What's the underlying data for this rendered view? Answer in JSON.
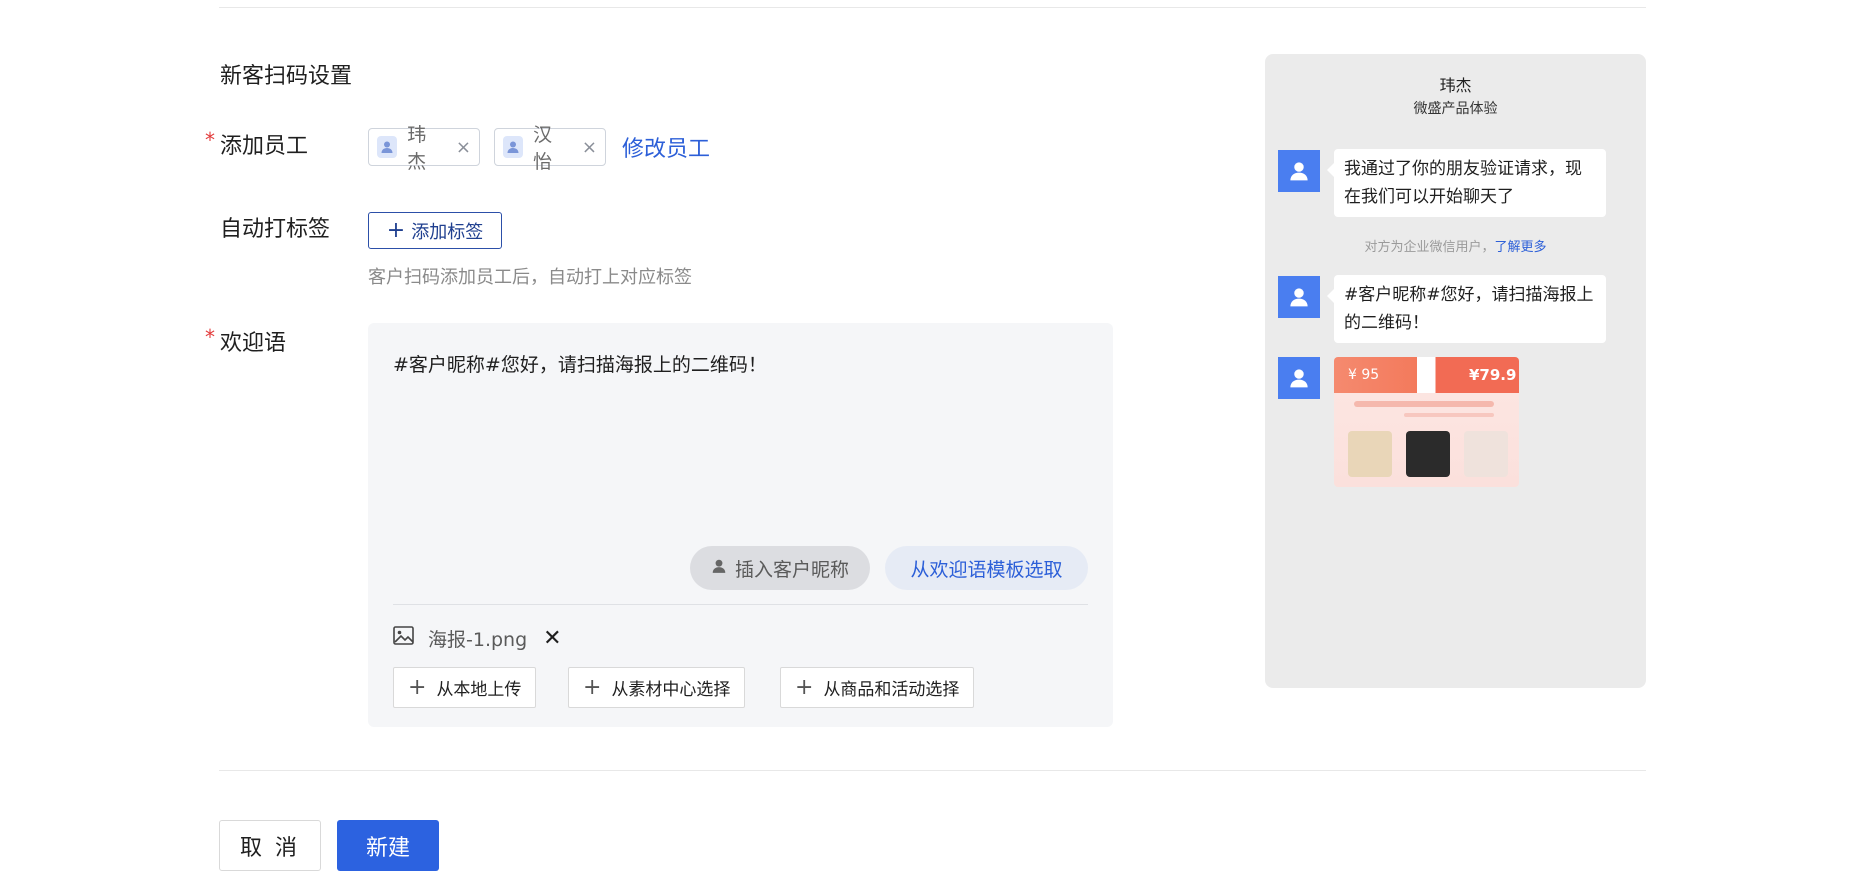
{
  "section_title": "新客扫码设置",
  "form": {
    "add_staff": {
      "label": "添加员工",
      "chips": [
        {
          "name": "玮杰"
        },
        {
          "name": "汉怡"
        }
      ],
      "modify_link": "修改员工"
    },
    "auto_tag": {
      "label": "自动打标签",
      "add_button": "添加标签",
      "hint": "客户扫码添加员工后，自动打上对应标签"
    },
    "welcome": {
      "label": "欢迎语",
      "text": "#客户昵称#您好，请扫描海报上的二维码！",
      "insert_nickname": "插入客户昵称",
      "from_template": "从欢迎语模板选取",
      "attachment": "海报-1.png",
      "upload_buttons": [
        "从本地上传",
        "从素材中心选择",
        "从商品和活动选择"
      ]
    }
  },
  "preview": {
    "name": "玮杰",
    "company": "微盛产品体验",
    "message1": "我通过了你的朋友验证请求，现在我们可以开始聊天了",
    "system_text": "对方为企业微信用户，",
    "system_link": "了解更多",
    "message2": "#客户昵称#您好，请扫描海报上的二维码！",
    "poster_price1": "¥ 95",
    "poster_price2": "¥79.9"
  },
  "actions": {
    "cancel": "取 消",
    "create": "新建"
  },
  "colors": {
    "accent": "#2c62e0",
    "required": "#e23b3b",
    "avatar": "#4a7ef0"
  }
}
